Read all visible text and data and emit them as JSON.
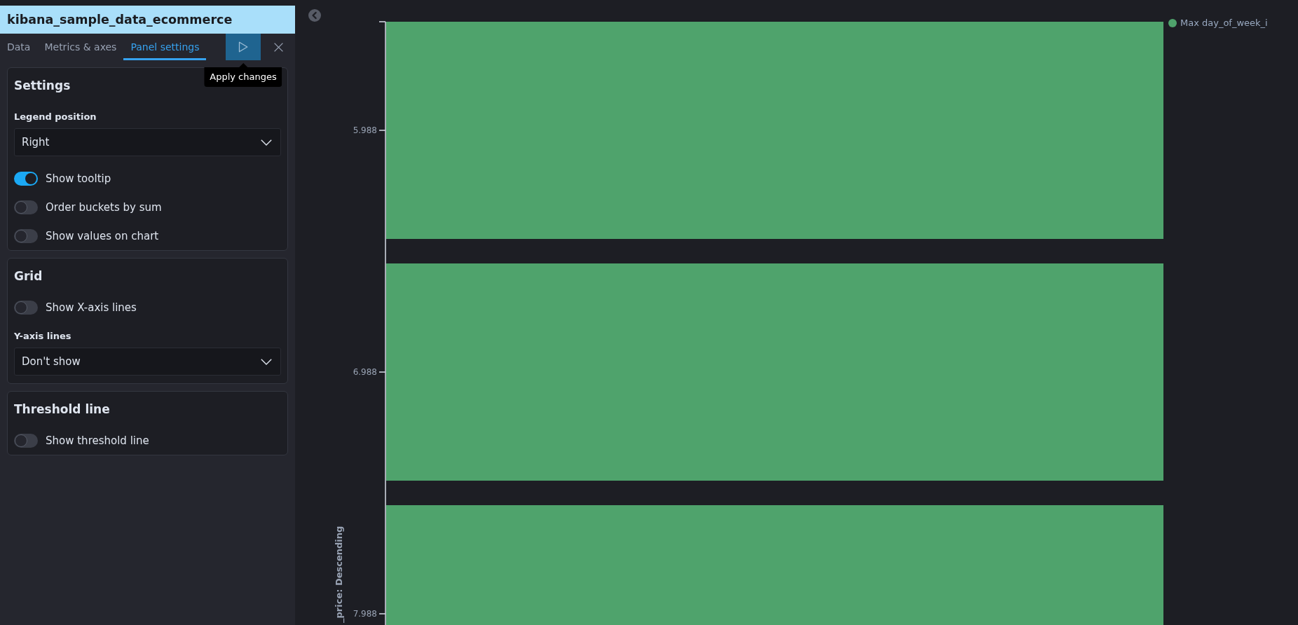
{
  "editor": {
    "title": "kibana_sample_data_ecommerce",
    "tabs": [
      {
        "label": "Data",
        "selected": false
      },
      {
        "label": "Metrics & axes",
        "selected": false
      },
      {
        "label": "Panel settings",
        "selected": true
      }
    ],
    "apply_tooltip": "Apply changes"
  },
  "sections": [
    {
      "title": "Settings",
      "controls": [
        {
          "kind": "select",
          "label": "Legend position",
          "value": "Right"
        },
        {
          "kind": "toggle",
          "label": "Show tooltip",
          "on": true
        },
        {
          "kind": "toggle",
          "label": "Order buckets by sum",
          "on": false
        },
        {
          "kind": "toggle",
          "label": "Show values on chart",
          "on": false
        }
      ]
    },
    {
      "title": "Grid",
      "controls": [
        {
          "kind": "toggle",
          "label": "Show X-axis lines",
          "on": false
        },
        {
          "kind": "select",
          "label": "Y-axis lines",
          "value": "Don't show"
        }
      ]
    },
    {
      "title": "Threshold line",
      "controls": [
        {
          "kind": "toggle",
          "label": "Show threshold line",
          "on": false
        }
      ]
    }
  ],
  "chart": {
    "y_axis": {
      "title": "_price: Descending",
      "labels": [
        "5.988",
        "6.988",
        "7.988"
      ]
    },
    "legend": [
      {
        "label": "Max day_of_week_i",
        "color": "#4fa36c"
      }
    ]
  }
}
